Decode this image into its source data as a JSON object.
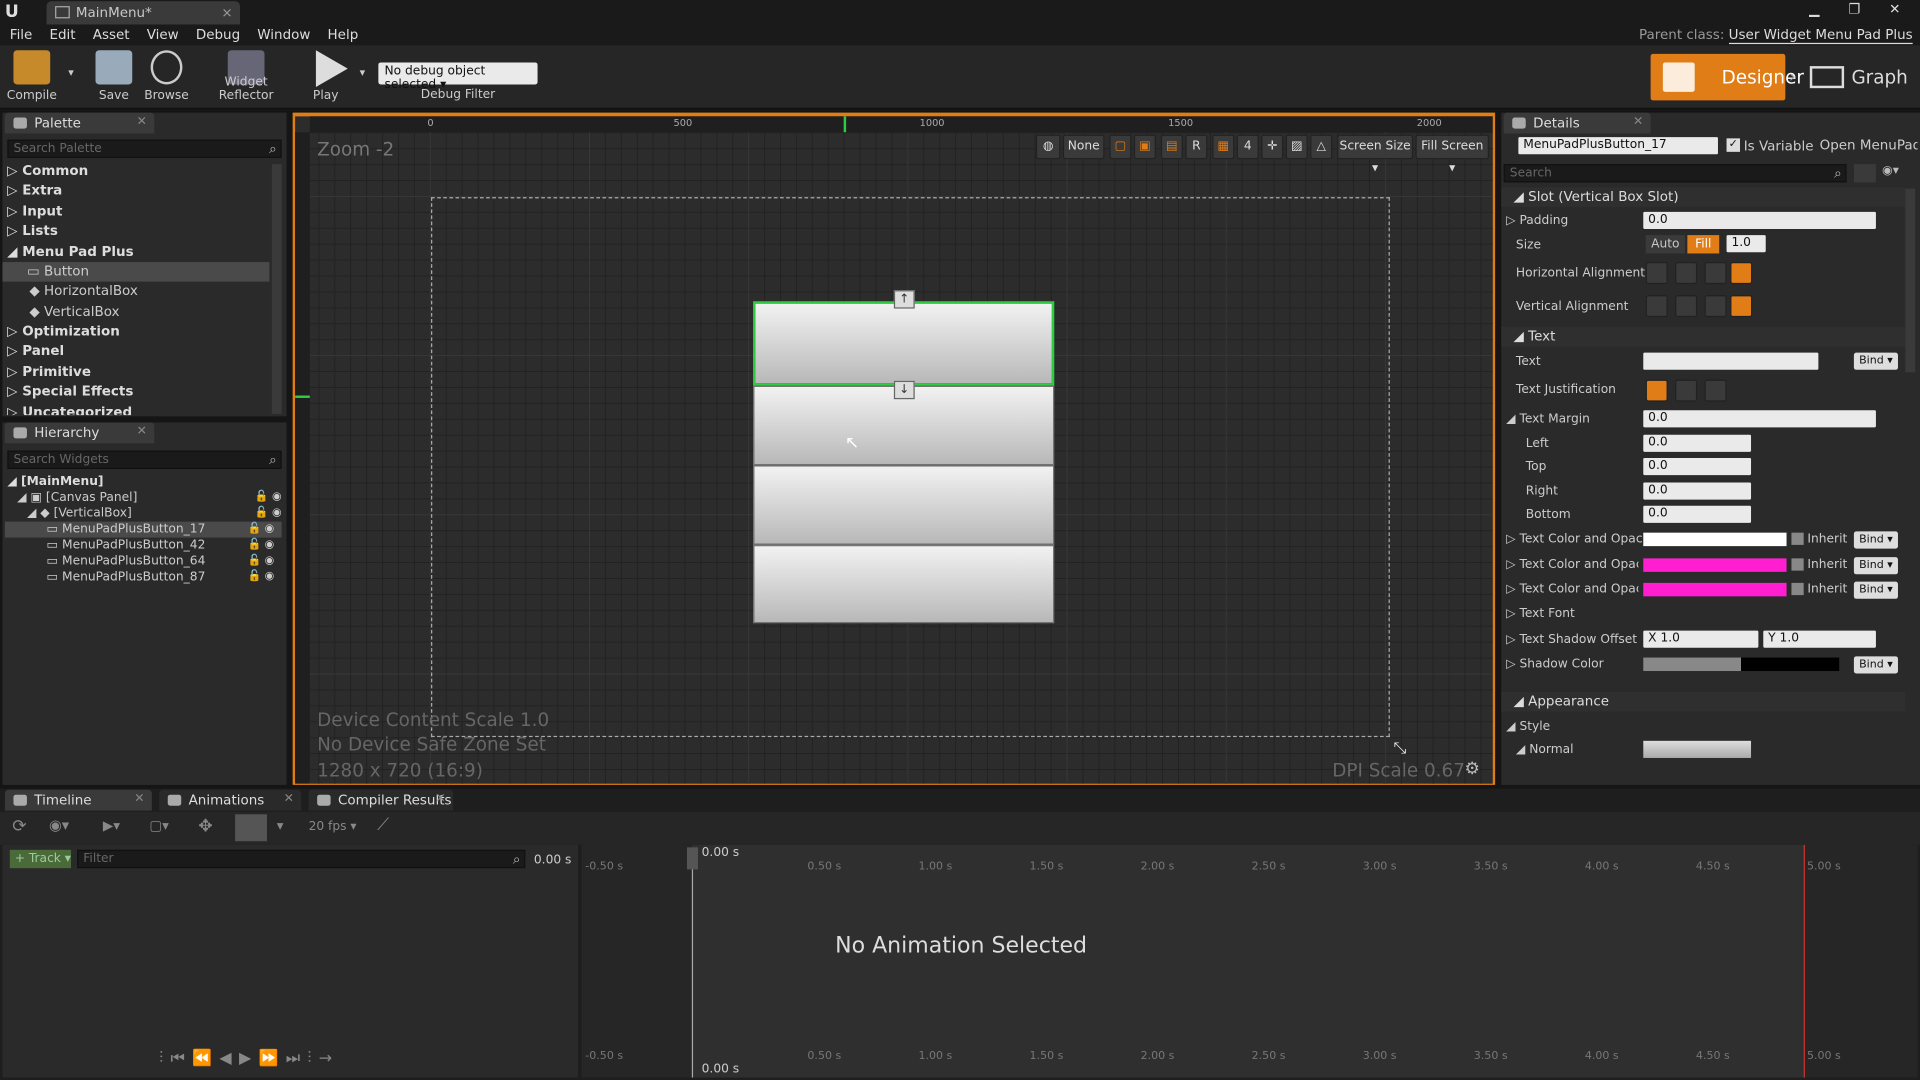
{
  "window": {
    "tab_title": "MainMenu*",
    "parent_class_label": "Parent class:",
    "parent_class": "User Widget Menu Pad Plus"
  },
  "menu": [
    "File",
    "Edit",
    "Asset",
    "View",
    "Debug",
    "Window",
    "Help"
  ],
  "toolbar": {
    "compile": "Compile",
    "save": "Save",
    "browse": "Browse",
    "widget_reflector": "Widget Reflector",
    "play": "Play",
    "debug_select": "No debug object selected",
    "debug_filter": "Debug Filter"
  },
  "modes": {
    "designer": "Designer",
    "graph": "Graph"
  },
  "palette": {
    "tab": "Palette",
    "search_placeholder": "Search Palette",
    "categories": [
      "Common",
      "Extra",
      "Input",
      "Lists",
      "Menu Pad Plus"
    ],
    "menupad_items": [
      "Button",
      "HorizontalBox",
      "VerticalBox"
    ],
    "categories2": [
      "Optimization",
      "Panel",
      "Primitive",
      "Special Effects",
      "Uncategorized"
    ]
  },
  "hierarchy": {
    "tab": "Hierarchy",
    "search_placeholder": "Search Widgets",
    "root": "[MainMenu]",
    "canvas": "[Canvas Panel]",
    "vbox": "[VerticalBox]",
    "items": [
      "MenuPadPlusButton_17",
      "MenuPadPlusButton_42",
      "MenuPadPlusButton_64",
      "MenuPadPlusButton_87"
    ]
  },
  "viewport": {
    "zoom": "Zoom -2",
    "device_scale": "Device Content Scale 1.0",
    "safe_zone": "No Device Safe Zone Set",
    "resolution": "1280 x 720 (16:9)",
    "dpi": "DPI Scale 0.67",
    "ruler": [
      "0",
      "500",
      "1000",
      "1500",
      "2000"
    ],
    "tool_none": "None",
    "tool_r": "R",
    "tool_grid": "4",
    "screen_size": "Screen Size",
    "fill_screen": "Fill Screen"
  },
  "details": {
    "tab": "Details",
    "name": "MenuPadPlusButton_17",
    "is_variable": "Is Variable",
    "open": "Open MenuPadPl",
    "search_placeholder": "Search",
    "slot_header": "Slot (Vertical Box Slot)",
    "padding_label": "Padding",
    "padding": "0.0",
    "size_label": "Size",
    "size_auto": "Auto",
    "size_fill": "Fill",
    "size_val": "1.0",
    "halign": "Horizontal Alignment",
    "valign": "Vertical Alignment",
    "text_header": "Text",
    "text_label": "Text",
    "bind": "Bind",
    "justification": "Text Justification",
    "margin_label": "Text Margin",
    "margin": "0.0",
    "left": "Left",
    "top": "Top",
    "right": "Right",
    "bottom": "Bottom",
    "zero": "0.0",
    "color1": "Text Color and Opacity",
    "color2": "Text Color and Opacity H",
    "color3": "Text Color and Opacity P",
    "inherit": "Inherit",
    "font": "Text Font",
    "shadow_offset": "Text Shadow Offset",
    "sx": "X  1.0",
    "sy": "Y  1.0",
    "shadow_color": "Shadow Color",
    "appearance": "Appearance",
    "style": "Style",
    "normal": "Normal"
  },
  "colors": {
    "accent": "#e07d16",
    "magenta": "#ff1fd0",
    "select": "#2ecc40"
  },
  "timeline": {
    "tab_timeline": "Timeline",
    "tab_animations": "Animations",
    "tab_compiler": "Compiler Results",
    "fps": "20 fps",
    "track": "+ Track",
    "filter_placeholder": "Filter",
    "time": "0.00 s",
    "no_anim": "No Animation Selected",
    "ticks": [
      "-0.50 s",
      "0.50 s",
      "1.00 s",
      "1.50 s",
      "2.00 s",
      "2.50 s",
      "3.00 s",
      "3.50 s",
      "4.00 s",
      "4.50 s",
      "5.00 s"
    ]
  }
}
